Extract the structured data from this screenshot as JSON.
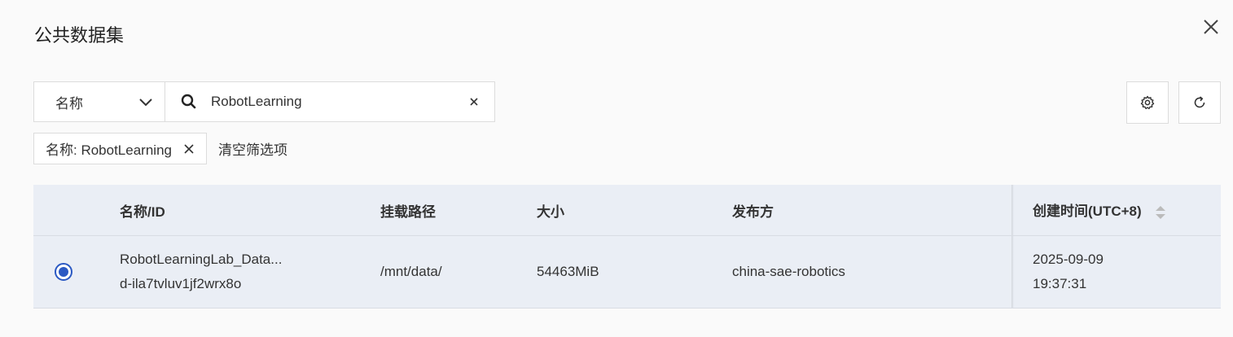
{
  "dialog": {
    "title": "公共数据集"
  },
  "filter": {
    "field_label": "名称",
    "search_value": "RobotLearning",
    "active_tag": "名称: RobotLearning",
    "clear_label": "清空筛选项"
  },
  "table": {
    "headers": {
      "name": "名称/ID",
      "path": "挂载路径",
      "size": "大小",
      "publisher": "发布方",
      "created": "创建时间(UTC+8)"
    },
    "rows": [
      {
        "selected": true,
        "name": "RobotLearningLab_Data...",
        "id": "d-ila7tvluv1jf2wrx8o",
        "path": "/mnt/data/",
        "size": "54463MiB",
        "publisher": "china-sae-robotics",
        "created_date": "2025-09-09",
        "created_time": "19:37:31"
      }
    ]
  },
  "icons": {
    "close": "close-icon",
    "chevron": "chevron-down-icon",
    "search": "search-icon",
    "clear": "clear-icon",
    "settings": "gear-icon",
    "refresh": "refresh-icon",
    "sort": "sort-icon"
  },
  "colors": {
    "accent": "#2b59c3",
    "table_bg": "#eaeef5"
  }
}
